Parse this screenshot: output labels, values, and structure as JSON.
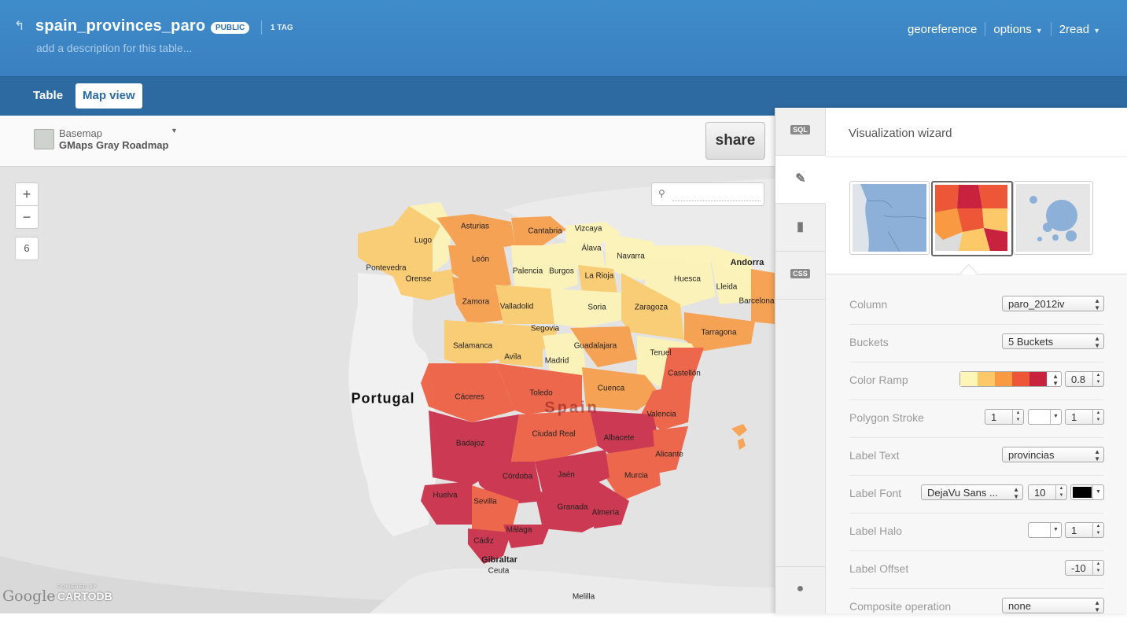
{
  "header": {
    "title": "spain_provinces_paro",
    "badge": "PUBLIC",
    "tags": "1 TAG",
    "description_placeholder": "add a description for this table...",
    "nav": [
      {
        "label": "georeference"
      },
      {
        "label": "options"
      },
      {
        "label": "2read"
      }
    ]
  },
  "tabs": {
    "table": "Table",
    "map": "Map view"
  },
  "toolbar": {
    "basemap_kicker": "Basemap",
    "basemap_name": "GMaps Gray Roadmap",
    "share": "share"
  },
  "map": {
    "zoom_in": "+",
    "zoom_out": "−",
    "zoom_level": "6",
    "search_placeholder": "",
    "countries": {
      "portugal": "Portugal",
      "spain": "Spain",
      "andorra": "Andorra",
      "gibraltar": "Gibraltar"
    },
    "places": [
      "Ceuta",
      "Melilla"
    ],
    "provinces": [
      "Lugo",
      "Asturias",
      "Cantabria",
      "Vizcaya",
      "Pontevedra",
      "León",
      "Álava",
      "Navarra",
      "Orense",
      "Palencia",
      "Burgos",
      "La Rioja",
      "Huesca",
      "Lleida",
      "Zamora",
      "Valladolid",
      "Soria",
      "Zaragoza",
      "Barcelona",
      "Segovia",
      "Salamanca",
      "Guadalajara",
      "Tarragona",
      "Avila",
      "Madrid",
      "Teruel",
      "Castellón",
      "Cáceres",
      "Toledo",
      "Cuenca",
      "Valencia",
      "Ciudad Real",
      "Badajoz",
      "Albacete",
      "Alicante",
      "Córdoba",
      "Jaén",
      "Murcia",
      "Huelva",
      "Sevilla",
      "Granada",
      "Almería",
      "Málaga",
      "Cádiz"
    ],
    "attribution_google": "Google",
    "attribution_powered": "POWERED BY",
    "attribution_cartodb": "CARTODB",
    "colors": {
      "bucket1": "#fff5b5",
      "bucket2": "#fdc968",
      "bucket3": "#f99a42",
      "bucket4": "#ee5638",
      "bucket5": "#c8223f"
    }
  },
  "panel": {
    "sidebar_icons": [
      "sql-icon",
      "brush-icon",
      "comment-icon",
      "css-icon",
      "bulb-icon"
    ],
    "sidebar_labels": {
      "sql": "SQL",
      "css": "CSS"
    },
    "title": "Visualization wizard",
    "visualizations": [
      "simple",
      "choropleth",
      "bubble"
    ],
    "properties": {
      "column": {
        "label": "Column",
        "value": "paro_2012iv"
      },
      "buckets": {
        "label": "Buckets",
        "value": "5 Buckets"
      },
      "color_ramp": {
        "label": "Color Ramp",
        "opacity": "0.8"
      },
      "polygon_stroke": {
        "label": "Polygon Stroke",
        "width": "1",
        "opacity": "1"
      },
      "label_text": {
        "label": "Label Text",
        "value": "provincias"
      },
      "label_font": {
        "label": "Label Font",
        "font": "DejaVu Sans ...",
        "size": "10",
        "color": "#000000"
      },
      "label_halo": {
        "label": "Label Halo",
        "width": "1"
      },
      "label_offset": {
        "label": "Label Offset",
        "value": "-10"
      },
      "composite": {
        "label": "Composite operation",
        "value": "none"
      }
    }
  }
}
